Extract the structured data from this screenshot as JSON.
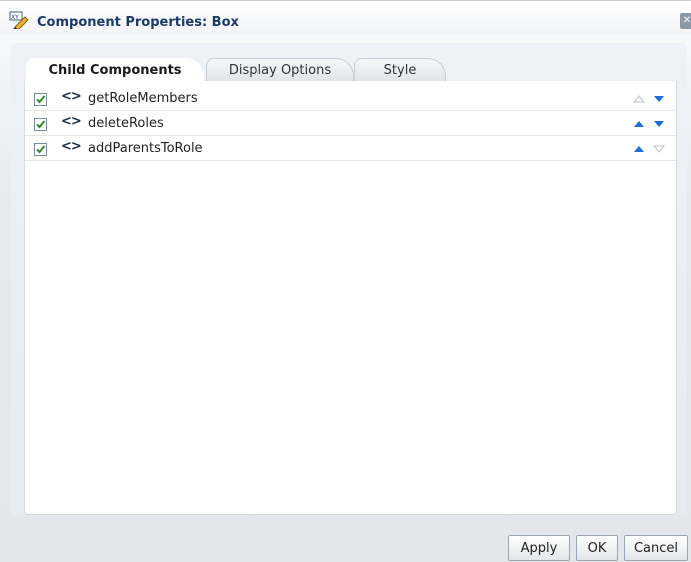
{
  "dialog": {
    "title": "Component Properties: Box",
    "close_icon": "close-icon",
    "title_icon": "edit-properties-icon"
  },
  "tabs": [
    {
      "label": "Child Components",
      "active": true
    },
    {
      "label": "Display Options",
      "active": false
    },
    {
      "label": "Style",
      "active": false
    }
  ],
  "child_components": [
    {
      "name": "getRoleMembers",
      "checked": true,
      "move_up_enabled": false,
      "move_down_enabled": true
    },
    {
      "name": "deleteRoles",
      "checked": true,
      "move_up_enabled": true,
      "move_down_enabled": true
    },
    {
      "name": "addParentsToRole",
      "checked": true,
      "move_up_enabled": true,
      "move_down_enabled": false
    }
  ],
  "buttons": {
    "apply": "Apply",
    "ok": "OK",
    "cancel": "Cancel"
  },
  "colors": {
    "accent_blue": "#1a6fd6",
    "disabled_arrow": "#b8c0ca",
    "check_green": "#2e8b2e"
  }
}
